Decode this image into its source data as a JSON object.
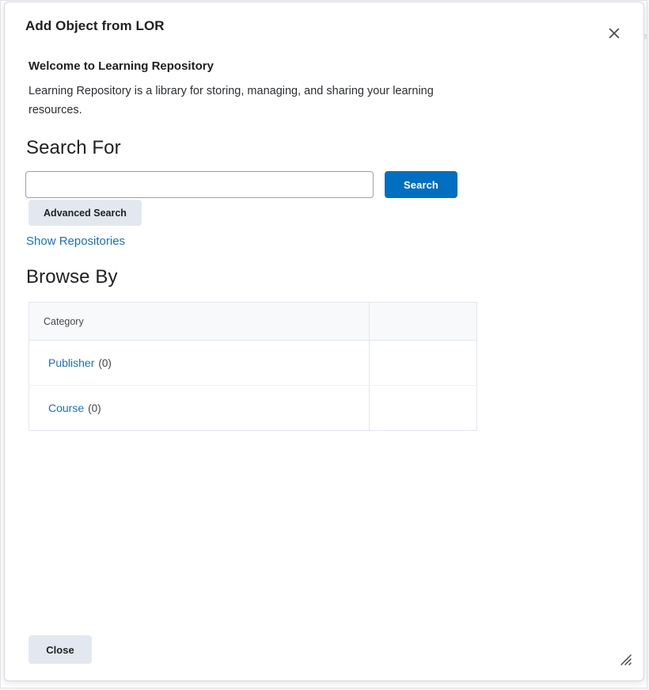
{
  "backdrop": {
    "clipped_text": "se"
  },
  "dialog": {
    "title": "Add Object from LOR",
    "close_icon": "close-icon",
    "welcome": {
      "heading": "Welcome to Learning Repository",
      "description": "Learning Repository is a library for storing, managing, and sharing your learning resources."
    },
    "search": {
      "heading": "Search For",
      "input_value": "",
      "input_placeholder": "",
      "search_button_label": "Search",
      "advanced_search_label": "Advanced Search",
      "show_repositories_label": "Show Repositories"
    },
    "browse": {
      "heading": "Browse By",
      "table": {
        "columns": [
          "Category",
          ""
        ],
        "rows": [
          {
            "name": "Publisher",
            "count": "(0)",
            "second": ""
          },
          {
            "name": "Course",
            "count": "(0)",
            "second": ""
          }
        ]
      }
    },
    "footer": {
      "close_label": "Close",
      "resize_icon": "resize-grip-icon"
    }
  },
  "colors": {
    "primary_blue": "#006fbf",
    "link_blue": "#1a70b8",
    "button_grey": "#e3e8f0",
    "border_grey": "#e2e6ed",
    "text_dark": "#202122"
  }
}
